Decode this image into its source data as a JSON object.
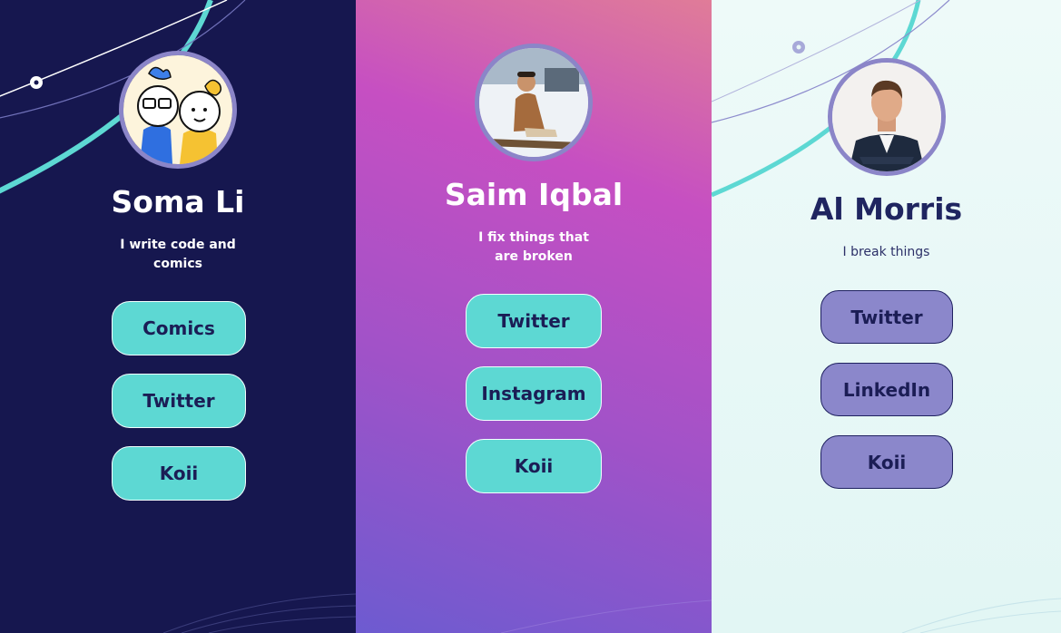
{
  "profiles": [
    {
      "name": "Soma Li",
      "bio": "I write code and comics",
      "links": [
        "Comics",
        "Twitter",
        "Koii"
      ]
    },
    {
      "name": "Saim Iqbal",
      "bio": "I fix things that are broken",
      "links": [
        "Twitter",
        "Instagram",
        "Koii"
      ]
    },
    {
      "name": "Al Morris",
      "bio": "I break things",
      "links": [
        "Twitter",
        "LinkedIn",
        "Koii"
      ]
    }
  ],
  "colors": {
    "navy": "#16174f",
    "teal": "#5dd8d3",
    "lavender": "#8b87cb",
    "pink": "#c64fc2",
    "violet": "#6d5bd0",
    "mint": "#e2f6f4"
  },
  "icons": {
    "avatar_1": "cartoon-avatar-icon",
    "avatar_2": "photo-avatar",
    "avatar_3": "photo-avatar"
  }
}
